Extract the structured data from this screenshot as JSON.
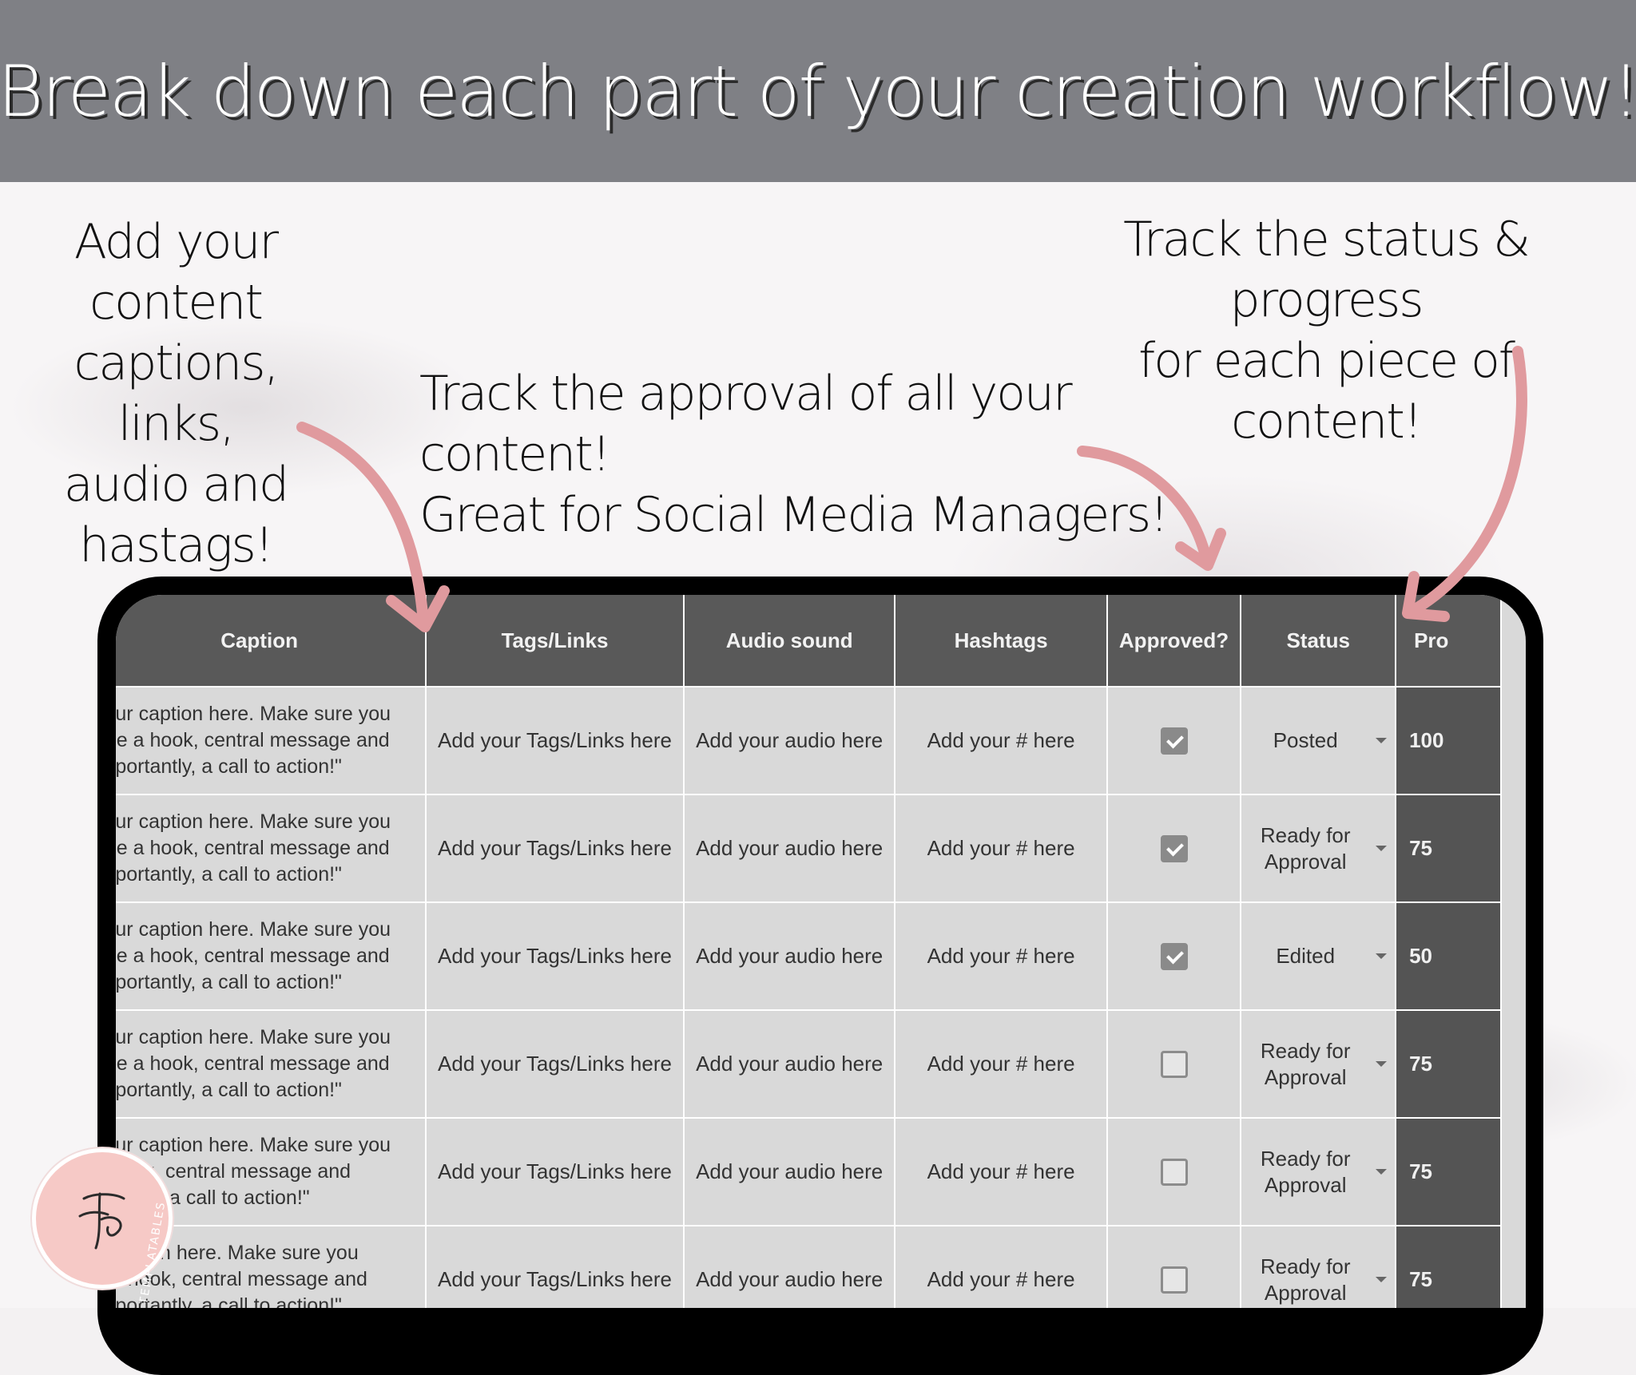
{
  "banner": {
    "title": "Break down each part of your creation workflow!"
  },
  "notes": {
    "left": [
      "Add your",
      "content",
      "captions, links,",
      "audio and",
      "hastags!"
    ],
    "middle": [
      "Track the approval of all your content!",
      "Great for Social Media Managers!"
    ],
    "right": [
      "Track the status & progress",
      "for each piece of content!"
    ]
  },
  "table": {
    "headers": [
      "Caption",
      "Tags/Links",
      "Audio sound",
      "Hashtags",
      "Approved?",
      "Status",
      "Pro"
    ],
    "rows": [
      {
        "caption": [
          "your caption here. Make sure you",
          "ude a hook, central message and",
          "importantly, a call to action!\""
        ],
        "tags": "Add your Tags/Links here",
        "audio": "Add your audio here",
        "hashtags": "Add your # here",
        "approved": true,
        "status": "Posted",
        "progress": "100"
      },
      {
        "caption": [
          "your caption here. Make sure you",
          "ude a hook, central message and",
          "importantly, a call to action!\""
        ],
        "tags": "Add your Tags/Links here",
        "audio": "Add your audio here",
        "hashtags": "Add your # here",
        "approved": true,
        "status": "Ready for Approval",
        "progress": "75"
      },
      {
        "caption": [
          "your caption here. Make sure you",
          "ude a hook, central message and",
          "importantly, a call to action!\""
        ],
        "tags": "Add your Tags/Links here",
        "audio": "Add your audio here",
        "hashtags": "Add your # here",
        "approved": true,
        "status": "Edited",
        "progress": "50"
      },
      {
        "caption": [
          "your caption here. Make sure you",
          "ude a hook, central message and",
          "importantly, a call to action!\""
        ],
        "tags": "Add your Tags/Links here",
        "audio": "Add your audio here",
        "hashtags": "Add your # here",
        "approved": false,
        "status": "Ready for Approval",
        "progress": "75"
      },
      {
        "caption": [
          "your caption here. Make sure you",
          "a hook, central message and",
          "ortantly, a call to action!\""
        ],
        "tags": "Add your Tags/Links here",
        "audio": "Add your audio here",
        "hashtags": "Add your # here",
        "approved": false,
        "status": "Ready for Approval",
        "progress": "75"
      },
      {
        "caption": [
          "r caption here. Make sure you",
          "e a hook, central message and",
          "importantly, a call to action!\""
        ],
        "tags": "Add your Tags/Links here",
        "audio": "Add your audio here",
        "hashtags": "Add your # here",
        "approved": false,
        "status": "Ready for Approval",
        "progress": "75"
      }
    ]
  },
  "logo": {
    "text": "TEMPLATABLES"
  },
  "colors": {
    "banner": "#7f8085",
    "header": "#595959",
    "cell": "#d9d9d9",
    "arrow": "#e09a9e",
    "logo": "#f6c9c6"
  }
}
